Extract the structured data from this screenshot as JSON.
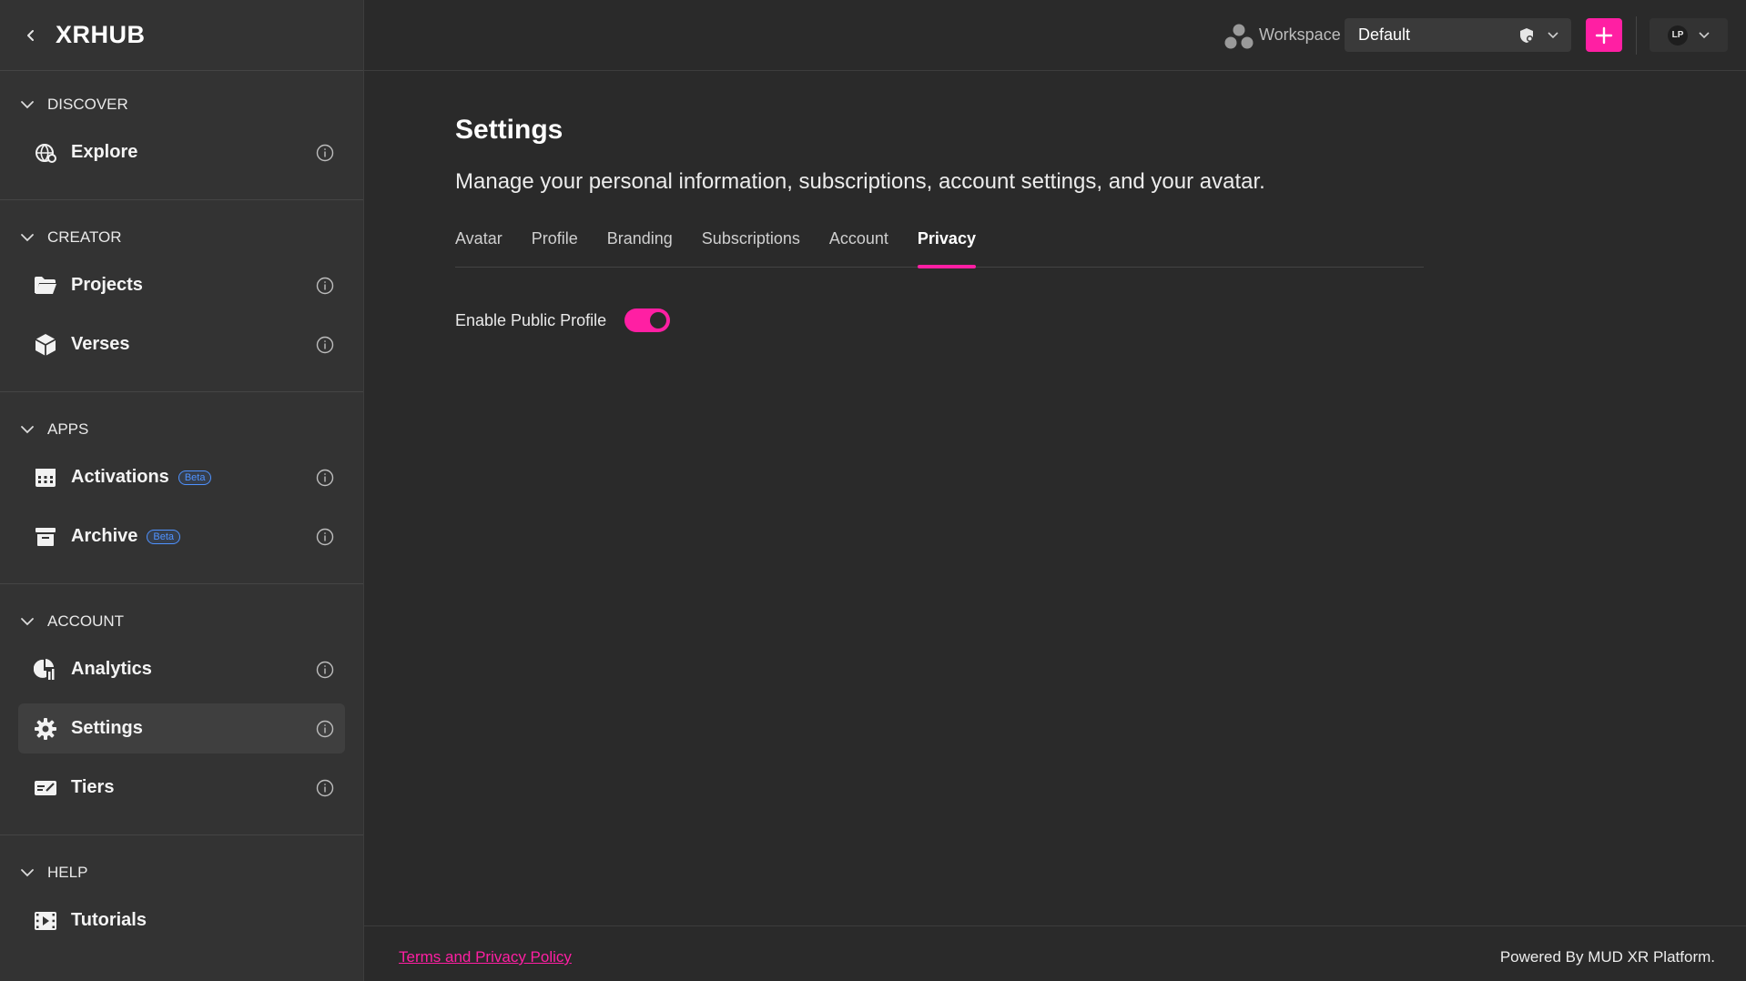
{
  "app": {
    "brand": "XRHUB"
  },
  "sidebar": {
    "sections": [
      {
        "title": "DISCOVER",
        "items": [
          {
            "label": "Explore",
            "icon": "globe-icon"
          }
        ]
      },
      {
        "title": "CREATOR",
        "items": [
          {
            "label": "Projects",
            "icon": "folder-icon"
          },
          {
            "label": "Verses",
            "icon": "cube-icon"
          }
        ]
      },
      {
        "title": "APPS",
        "items": [
          {
            "label": "Activations",
            "icon": "calendar-icon",
            "badge": "Beta"
          },
          {
            "label": "Archive",
            "icon": "archive-icon",
            "badge": "Beta"
          }
        ]
      },
      {
        "title": "ACCOUNT",
        "items": [
          {
            "label": "Analytics",
            "icon": "analytics-icon"
          },
          {
            "label": "Settings",
            "icon": "gear-icon",
            "active": true
          },
          {
            "label": "Tiers",
            "icon": "card-icon"
          }
        ]
      },
      {
        "title": "HELP",
        "items": [
          {
            "label": "Tutorials",
            "icon": "video-icon"
          }
        ]
      }
    ]
  },
  "topbar": {
    "workspace_label": "Workspace",
    "workspace_value": "Default",
    "avatar_initials": "LP"
  },
  "main": {
    "title": "Settings",
    "subtitle": "Manage your personal information, subscriptions, account settings, and your avatar.",
    "tabs": [
      {
        "label": "Avatar"
      },
      {
        "label": "Profile"
      },
      {
        "label": "Branding"
      },
      {
        "label": "Subscriptions"
      },
      {
        "label": "Account"
      },
      {
        "label": "Privacy",
        "active": true
      }
    ],
    "public_profile_label": "Enable Public Profile",
    "public_profile_enabled": true
  },
  "footer": {
    "terms": "Terms and Privacy Policy",
    "powered": "Powered By MUD XR Platform."
  },
  "colors": {
    "accent": "#ff1fa3",
    "beta": "#4f92ff",
    "sidebar_bg": "#333333",
    "main_bg": "#2a2a2a"
  }
}
